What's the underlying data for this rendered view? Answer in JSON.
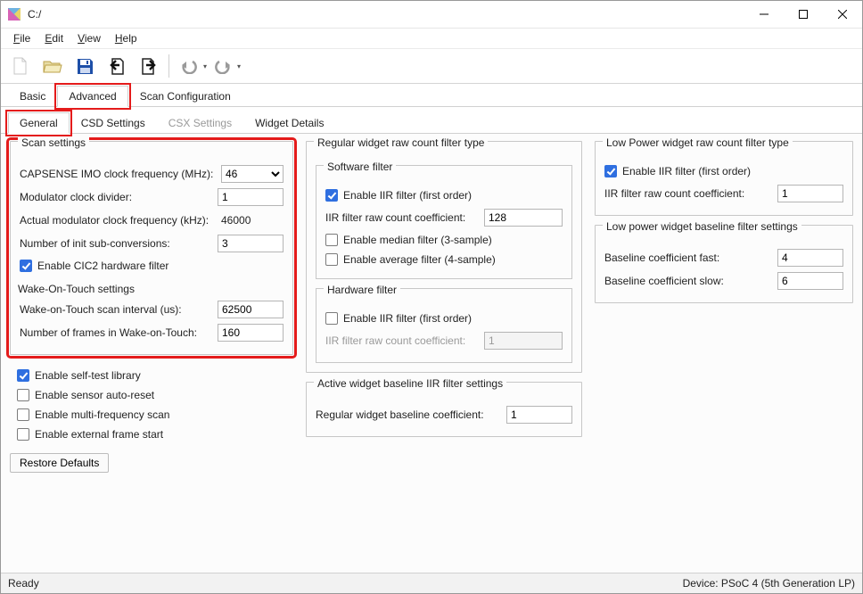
{
  "window": {
    "title": "C:/"
  },
  "menu": {
    "file": "File",
    "edit": "Edit",
    "view": "View",
    "help": "Help"
  },
  "toolbar_icons": {
    "new_file": "new-file-icon",
    "open_folder": "open-folder-icon",
    "save": "save-icon",
    "import": "import-icon",
    "export": "export-icon",
    "undo": "undo-icon",
    "redo": "redo-icon"
  },
  "top_tabs": [
    {
      "label": "Basic",
      "active": false,
      "highlighted": false
    },
    {
      "label": "Advanced",
      "active": true,
      "highlighted": true
    },
    {
      "label": "Scan Configuration",
      "active": false,
      "highlighted": false
    }
  ],
  "sub_tabs": [
    {
      "label": "General",
      "active": true,
      "highlighted": true,
      "disabled": false
    },
    {
      "label": "CSD Settings",
      "active": false,
      "highlighted": false,
      "disabled": false
    },
    {
      "label": "CSX Settings",
      "active": false,
      "highlighted": false,
      "disabled": true
    },
    {
      "label": "Widget Details",
      "active": false,
      "highlighted": false,
      "disabled": false
    }
  ],
  "scan_settings": {
    "title": "Scan settings",
    "imo_label": "CAPSENSE IMO clock frequency (MHz):",
    "imo_value": "46",
    "mod_div_label": "Modulator clock divider:",
    "mod_div_value": "1",
    "actual_freq_label": "Actual modulator clock frequency (kHz):",
    "actual_freq_value": "46000",
    "init_subconv_label": "Number of init sub-conversions:",
    "init_subconv_value": "3",
    "cic2_label": "Enable CIC2 hardware filter"
  },
  "wot": {
    "title": "Wake-On-Touch settings",
    "interval_label": "Wake-on-Touch scan interval (us):",
    "interval_value": "62500",
    "frames_label": "Number of frames in Wake-on-Touch:",
    "frames_value": "160"
  },
  "options": {
    "selftest": "Enable self-test library",
    "autoreset": "Enable sensor auto-reset",
    "multifreq": "Enable multi-frequency scan",
    "ext_frame": "Enable external frame start"
  },
  "restore_label": "Restore Defaults",
  "regular_filter": {
    "title": "Regular widget raw count filter type",
    "sw_title": "Software filter",
    "iir_label": "Enable IIR filter (first order)",
    "iir_coeff_label": "IIR filter raw count coefficient:",
    "iir_coeff_value": "128",
    "median_label": "Enable median filter (3-sample)",
    "avg_label": "Enable average filter (4-sample)",
    "hw_title": "Hardware filter",
    "hw_iir_label": "Enable IIR filter (first order)",
    "hw_iir_coeff_label": "IIR filter raw count coefficient:",
    "hw_iir_coeff_value": "1"
  },
  "active_baseline": {
    "title": "Active widget baseline IIR filter settings",
    "reg_coeff_label": "Regular widget baseline coefficient:",
    "reg_coeff_value": "1"
  },
  "lp_filter": {
    "title": "Low Power widget raw count filter type",
    "iir_label": "Enable IIR filter (first order)",
    "iir_coeff_label": "IIR filter raw count coefficient:",
    "iir_coeff_value": "1"
  },
  "lp_baseline": {
    "title": "Low power widget baseline filter settings",
    "fast_label": "Baseline coefficient fast:",
    "fast_value": "4",
    "slow_label": "Baseline coefficient slow:",
    "slow_value": "6"
  },
  "status": {
    "left": "Ready",
    "right": "Device: PSoC 4 (5th Generation LP)"
  }
}
